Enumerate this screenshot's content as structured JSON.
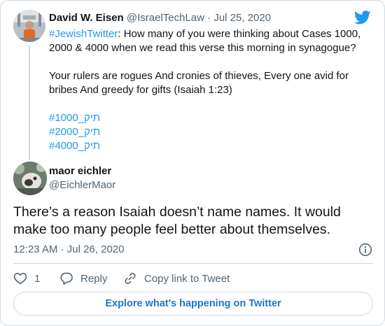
{
  "parent_tweet": {
    "author_name": "David W. Eisen",
    "handle": "@IsraelTechLaw",
    "separator": " · ",
    "date": "Jul 25, 2020",
    "hashtag": "#JewishTwitter",
    "text_1": ": How many of you were thinking about Cases 1000, 2000 & 4000 when we read this verse this morning in synagogue?",
    "text_2": "Your rulers are rogues  And cronies of thieves,  Every one avid for bribes  And greedy for gifts (Isaiah 1:23)",
    "tags": [
      "#תיק_1000",
      "#תיק_2000",
      "#תיק_4000"
    ]
  },
  "main_tweet": {
    "author_name": "maor eichler",
    "handle": "@EichlerMaor",
    "text": "There’s a reason Isaiah doesn’t name names. It would make too many people feel better about themselves.",
    "time": "12:23 AM",
    "separator": " · ",
    "date": "Jul 26, 2020"
  },
  "actions": {
    "like_count": "1",
    "reply_label": "Reply",
    "copy_link_label": "Copy link to Tweet"
  },
  "explore_button": {
    "label": "Explore what's happening on Twitter"
  },
  "icons": {
    "brand": "twitter-bird-icon",
    "like": "heart-icon",
    "reply": "reply-bubble-icon",
    "copy_link": "link-icon",
    "info": "info-icon"
  },
  "colors": {
    "accent": "#1d9bf0",
    "text": "#0f1419",
    "muted": "#536471",
    "border": "#cfd9de",
    "explore_text": "#1d76c6"
  }
}
